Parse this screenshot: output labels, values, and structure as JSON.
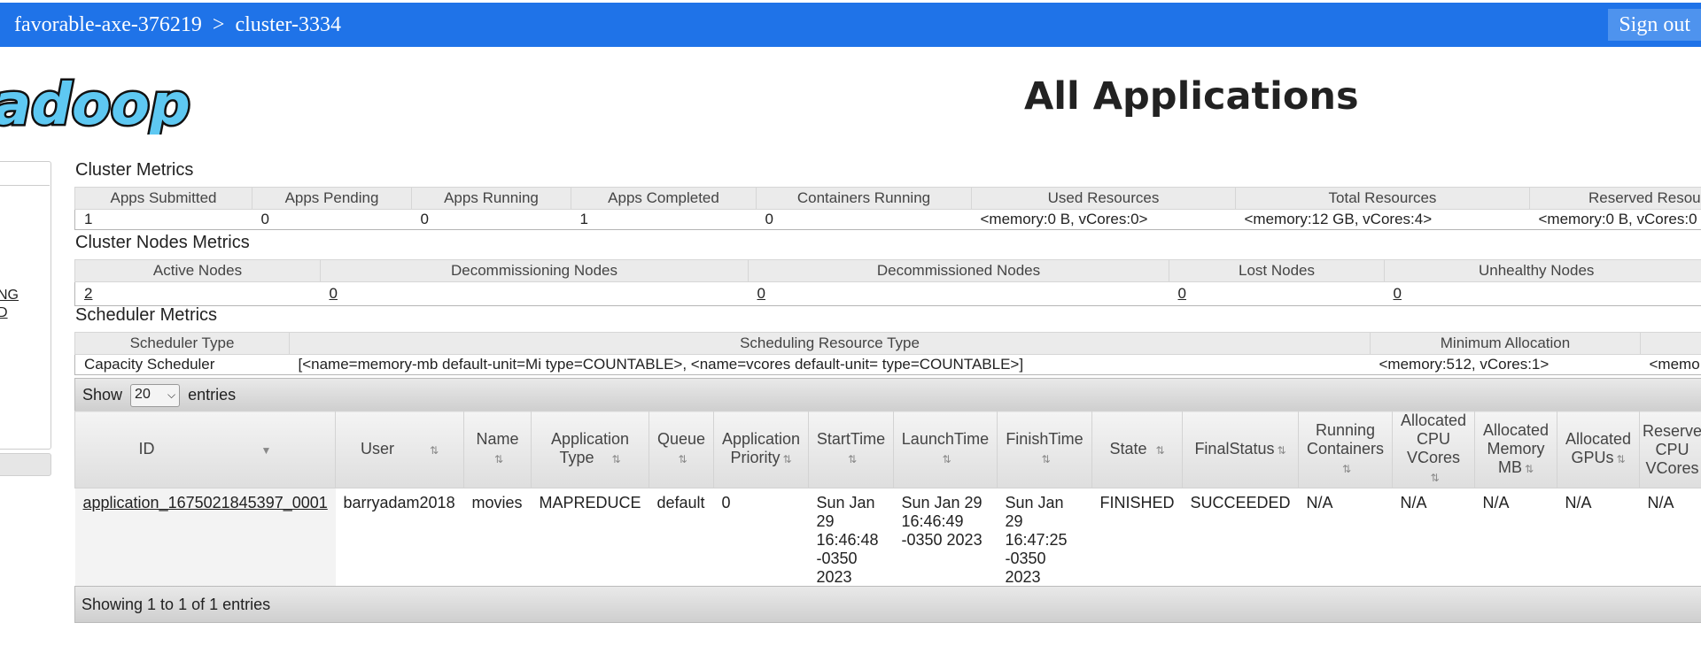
{
  "header": {
    "project": "favorable-axe-376219",
    "separator": ">",
    "cluster": "cluster-3334",
    "signout_label": "Sign out"
  },
  "logo": {
    "text": "adoop"
  },
  "page_title": "All Applications",
  "sidebar": {
    "links": [
      "NG",
      "D"
    ]
  },
  "cluster_metrics": {
    "title": "Cluster Metrics",
    "headers": [
      "Apps Submitted",
      "Apps Pending",
      "Apps Running",
      "Apps Completed",
      "Containers Running",
      "Used Resources",
      "Total Resources",
      "Reserved Resou"
    ],
    "values": [
      "1",
      "0",
      "0",
      "1",
      "0",
      "<memory:0 B, vCores:0>",
      "<memory:12 GB, vCores:4>",
      "<memory:0 B, vCores:0"
    ]
  },
  "cluster_nodes_metrics": {
    "title": "Cluster Nodes Metrics",
    "headers": [
      "Active Nodes",
      "Decommissioning Nodes",
      "Decommissioned Nodes",
      "Lost Nodes",
      "Unhealthy Nodes"
    ],
    "values": [
      "2",
      "0",
      "0",
      "0",
      "0"
    ]
  },
  "scheduler_metrics": {
    "title": "Scheduler Metrics",
    "headers": [
      "Scheduler Type",
      "Scheduling Resource Type",
      "Minimum Allocation",
      ""
    ],
    "values": [
      "Capacity Scheduler",
      "[<name=memory-mb default-unit=Mi type=COUNTABLE>, <name=vcores default-unit= type=COUNTABLE>]",
      "<memory:512, vCores:1>",
      "<memo"
    ]
  },
  "datatable": {
    "show_label": "Show",
    "page_size": "20",
    "entries_label": "entries",
    "info": "Showing 1 to 1 of 1 entries",
    "columns": [
      {
        "l1": "ID",
        "l2": ""
      },
      {
        "l1": "User",
        "l2": ""
      },
      {
        "l1": "Name",
        "l2": ""
      },
      {
        "l1": "Application",
        "l2": "Type"
      },
      {
        "l1": "Queue",
        "l2": ""
      },
      {
        "l1": "Application",
        "l2": "Priority"
      },
      {
        "l1": "StartTime",
        "l2": ""
      },
      {
        "l1": "LaunchTime",
        "l2": ""
      },
      {
        "l1": "FinishTime",
        "l2": ""
      },
      {
        "l1": "State",
        "l2": ""
      },
      {
        "l1": "FinalStatus",
        "l2": ""
      },
      {
        "l1": "Running",
        "l2": "Containers"
      },
      {
        "l1": "Allocated",
        "l2": "CPU",
        "l3": "VCores"
      },
      {
        "l1": "Allocated",
        "l2": "Memory",
        "l3": "MB"
      },
      {
        "l1": "Allocated",
        "l2": "GPUs"
      },
      {
        "l1": "Reserve",
        "l2": "CPU",
        "l3": "VCores"
      }
    ],
    "rows": [
      {
        "id": "application_1675021845397_0001",
        "user": "barryadam2018",
        "name": "movies",
        "type": "MAPREDUCE",
        "queue": "default",
        "priority": "0",
        "start": [
          "Sun Jan",
          "29",
          "16:46:48",
          "-0350",
          "2023"
        ],
        "launch": [
          "Sun Jan 29",
          "16:46:49",
          "-0350 2023"
        ],
        "finish": [
          "Sun Jan",
          "29",
          "16:47:25",
          "-0350",
          "2023"
        ],
        "state": "FINISHED",
        "final_status": "SUCCEEDED",
        "running_containers": "N/A",
        "alloc_cpu": "N/A",
        "alloc_mem": "N/A",
        "alloc_gpu": "N/A",
        "reserved_cpu": "N/A"
      }
    ]
  },
  "colors": {
    "topbar": "#1f73e8",
    "logo_fill": "#5ec8f2"
  }
}
